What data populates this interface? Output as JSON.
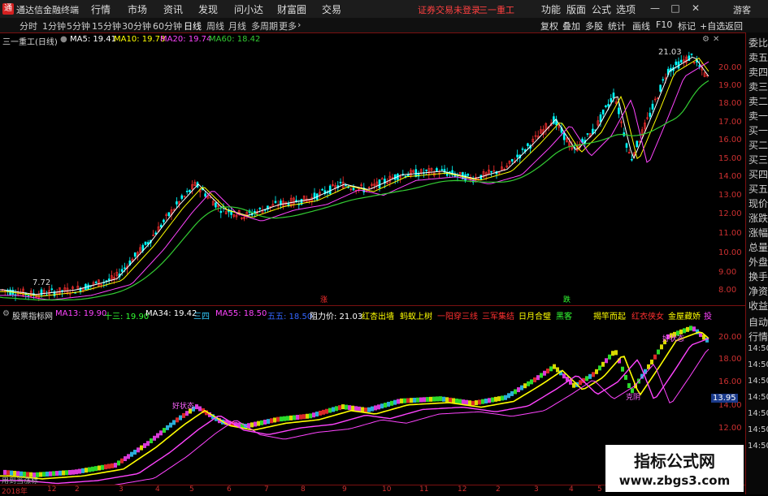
{
  "app": {
    "title": "通达信金融终端",
    "logo_text": "通",
    "menu": [
      "行情",
      "市场",
      "资讯",
      "发现",
      "问小达",
      "财富圈",
      "交易"
    ],
    "login_notice": "证券交易未登录",
    "stock_name_top": "三一重工",
    "right_menu": [
      "功能",
      "版面",
      "公式",
      "选项"
    ],
    "window_buttons": [
      "—",
      "□",
      "✕"
    ],
    "guest": "游客"
  },
  "periods": [
    "分时",
    "1分钟",
    "5分钟",
    "15分钟",
    "30分钟",
    "60分钟",
    "日线",
    "周线",
    "月线",
    "多周期",
    "更多"
  ],
  "active_period": "日线",
  "toolbar_right": [
    "复权",
    "叠加",
    "多股",
    "统计",
    "画线",
    "F10",
    "标记",
    "+自选",
    "返回"
  ],
  "main_chart": {
    "title": "三一重工(日线)",
    "legend": [
      {
        "label": "MA5: 19.41",
        "color": "#ffffff"
      },
      {
        "label": "MA10: 19.78",
        "color": "#ffff00"
      },
      {
        "label": "MA20: 19.74",
        "color": "#ff44ff"
      },
      {
        "label": "MA60: 18.42",
        "color": "#33cc33"
      }
    ],
    "y_labels": [
      "20.00",
      "19.00",
      "18.00",
      "17.00",
      "16.00",
      "15.00",
      "14.00",
      "13.00",
      "12.00",
      "11.00",
      "10.00",
      "9.00",
      "8.00"
    ],
    "high_annotation": "21.03",
    "low_annotation": "7.72",
    "up_marker": "涨",
    "down_marker": "跌",
    "colors": {
      "up": "#ff3030",
      "down": "#00ffff",
      "ma5": "#ffffff",
      "ma10": "#ffff00",
      "ma20": "#ff44ff",
      "ma60": "#33cc33"
    }
  },
  "sub_chart": {
    "title": "股票指标网",
    "legend": [
      {
        "label": "MA13: 19.90",
        "color": "#ff44ff"
      },
      {
        "label": "十三: 19.90",
        "color": "#33ff33"
      },
      {
        "label": "MA34: 19.42",
        "color": "#ffffff"
      },
      {
        "label": "三四",
        "color": "#33ccff"
      },
      {
        "label": "MA55: 18.50",
        "color": "#ff44ff"
      },
      {
        "label": "五五: 18.50",
        "color": "#3366ff"
      },
      {
        "label": "阻力价: 21.03",
        "color": "#ffffff"
      },
      {
        "label": "红杏出墙",
        "color": "#ffff00"
      },
      {
        "label": "蚂蚁上树",
        "color": "#ffff00"
      },
      {
        "label": "一阳穿三线",
        "color": "#ff3030"
      },
      {
        "label": "三军集结",
        "color": "#ff3030"
      },
      {
        "label": "日月合璧",
        "color": "#ffff00"
      },
      {
        "label": "黑客",
        "color": "#33ff33"
      },
      {
        "label": "揭竿而起",
        "color": "#ffff00"
      },
      {
        "label": "红衣侠女",
        "color": "#ff3030"
      },
      {
        "label": "金屋藏娇",
        "color": "#ffff00"
      },
      {
        "label": "投",
        "color": "#ff44ff"
      }
    ],
    "y_labels": [
      "20.00",
      "18.00",
      "16.00",
      "14.00",
      "12.00"
    ],
    "price_tag": "13.95",
    "annotations": [
      "好状态",
      "好状态",
      "克阴"
    ],
    "bottom_text": "用到当涨标"
  },
  "sidebar": {
    "items": [
      "委比",
      "卖五",
      "卖四",
      "卖三",
      "卖二",
      "卖一",
      "买一",
      "买二",
      "买三",
      "买四",
      "买五",
      "现价",
      "涨跌",
      "涨幅",
      "总量",
      "外盘",
      "换手",
      "净资",
      "收益"
    ],
    "buttons": [
      "自动",
      "行情"
    ],
    "times": [
      "14:50",
      "14:50",
      "14:50",
      "14:50",
      "14:50",
      "14:50",
      "14:50"
    ]
  },
  "dates": [
    "2018年",
    "12",
    "2",
    "3",
    "4",
    "5",
    "6",
    "7",
    "8",
    "9",
    "10",
    "11",
    "12",
    "2",
    "3",
    "4",
    "5"
  ],
  "watermark": {
    "title": "指标公式网",
    "url": "www.zbgs3.com"
  }
}
